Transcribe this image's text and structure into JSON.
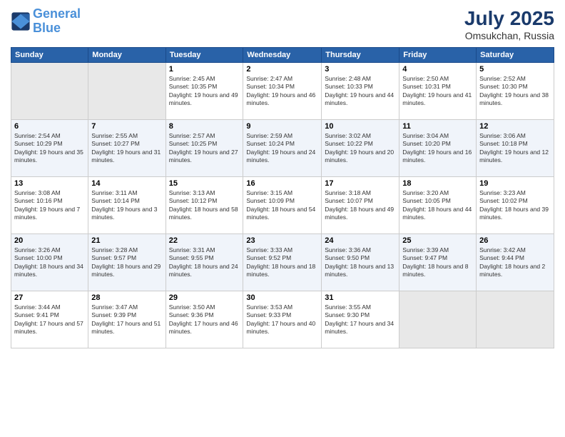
{
  "header": {
    "logo_line1": "General",
    "logo_line2": "Blue",
    "month": "July 2025",
    "location": "Omsukchan, Russia"
  },
  "days_of_week": [
    "Sunday",
    "Monday",
    "Tuesday",
    "Wednesday",
    "Thursday",
    "Friday",
    "Saturday"
  ],
  "weeks": [
    [
      {
        "day": "",
        "empty": true
      },
      {
        "day": "",
        "empty": true
      },
      {
        "day": "1",
        "sunrise": "2:45 AM",
        "sunset": "10:35 PM",
        "daylight": "19 hours and 49 minutes."
      },
      {
        "day": "2",
        "sunrise": "2:47 AM",
        "sunset": "10:34 PM",
        "daylight": "19 hours and 46 minutes."
      },
      {
        "day": "3",
        "sunrise": "2:48 AM",
        "sunset": "10:33 PM",
        "daylight": "19 hours and 44 minutes."
      },
      {
        "day": "4",
        "sunrise": "2:50 AM",
        "sunset": "10:31 PM",
        "daylight": "19 hours and 41 minutes."
      },
      {
        "day": "5",
        "sunrise": "2:52 AM",
        "sunset": "10:30 PM",
        "daylight": "19 hours and 38 minutes."
      }
    ],
    [
      {
        "day": "6",
        "sunrise": "2:54 AM",
        "sunset": "10:29 PM",
        "daylight": "19 hours and 35 minutes."
      },
      {
        "day": "7",
        "sunrise": "2:55 AM",
        "sunset": "10:27 PM",
        "daylight": "19 hours and 31 minutes."
      },
      {
        "day": "8",
        "sunrise": "2:57 AM",
        "sunset": "10:25 PM",
        "daylight": "19 hours and 27 minutes."
      },
      {
        "day": "9",
        "sunrise": "2:59 AM",
        "sunset": "10:24 PM",
        "daylight": "19 hours and 24 minutes."
      },
      {
        "day": "10",
        "sunrise": "3:02 AM",
        "sunset": "10:22 PM",
        "daylight": "19 hours and 20 minutes."
      },
      {
        "day": "11",
        "sunrise": "3:04 AM",
        "sunset": "10:20 PM",
        "daylight": "19 hours and 16 minutes."
      },
      {
        "day": "12",
        "sunrise": "3:06 AM",
        "sunset": "10:18 PM",
        "daylight": "19 hours and 12 minutes."
      }
    ],
    [
      {
        "day": "13",
        "sunrise": "3:08 AM",
        "sunset": "10:16 PM",
        "daylight": "19 hours and 7 minutes."
      },
      {
        "day": "14",
        "sunrise": "3:11 AM",
        "sunset": "10:14 PM",
        "daylight": "19 hours and 3 minutes."
      },
      {
        "day": "15",
        "sunrise": "3:13 AM",
        "sunset": "10:12 PM",
        "daylight": "18 hours and 58 minutes."
      },
      {
        "day": "16",
        "sunrise": "3:15 AM",
        "sunset": "10:09 PM",
        "daylight": "18 hours and 54 minutes."
      },
      {
        "day": "17",
        "sunrise": "3:18 AM",
        "sunset": "10:07 PM",
        "daylight": "18 hours and 49 minutes."
      },
      {
        "day": "18",
        "sunrise": "3:20 AM",
        "sunset": "10:05 PM",
        "daylight": "18 hours and 44 minutes."
      },
      {
        "day": "19",
        "sunrise": "3:23 AM",
        "sunset": "10:02 PM",
        "daylight": "18 hours and 39 minutes."
      }
    ],
    [
      {
        "day": "20",
        "sunrise": "3:26 AM",
        "sunset": "10:00 PM",
        "daylight": "18 hours and 34 minutes."
      },
      {
        "day": "21",
        "sunrise": "3:28 AM",
        "sunset": "9:57 PM",
        "daylight": "18 hours and 29 minutes."
      },
      {
        "day": "22",
        "sunrise": "3:31 AM",
        "sunset": "9:55 PM",
        "daylight": "18 hours and 24 minutes."
      },
      {
        "day": "23",
        "sunrise": "3:33 AM",
        "sunset": "9:52 PM",
        "daylight": "18 hours and 18 minutes."
      },
      {
        "day": "24",
        "sunrise": "3:36 AM",
        "sunset": "9:50 PM",
        "daylight": "18 hours and 13 minutes."
      },
      {
        "day": "25",
        "sunrise": "3:39 AM",
        "sunset": "9:47 PM",
        "daylight": "18 hours and 8 minutes."
      },
      {
        "day": "26",
        "sunrise": "3:42 AM",
        "sunset": "9:44 PM",
        "daylight": "18 hours and 2 minutes."
      }
    ],
    [
      {
        "day": "27",
        "sunrise": "3:44 AM",
        "sunset": "9:41 PM",
        "daylight": "17 hours and 57 minutes."
      },
      {
        "day": "28",
        "sunrise": "3:47 AM",
        "sunset": "9:39 PM",
        "daylight": "17 hours and 51 minutes."
      },
      {
        "day": "29",
        "sunrise": "3:50 AM",
        "sunset": "9:36 PM",
        "daylight": "17 hours and 46 minutes."
      },
      {
        "day": "30",
        "sunrise": "3:53 AM",
        "sunset": "9:33 PM",
        "daylight": "17 hours and 40 minutes."
      },
      {
        "day": "31",
        "sunrise": "3:55 AM",
        "sunset": "9:30 PM",
        "daylight": "17 hours and 34 minutes."
      },
      {
        "day": "",
        "empty": true
      },
      {
        "day": "",
        "empty": true
      }
    ]
  ]
}
